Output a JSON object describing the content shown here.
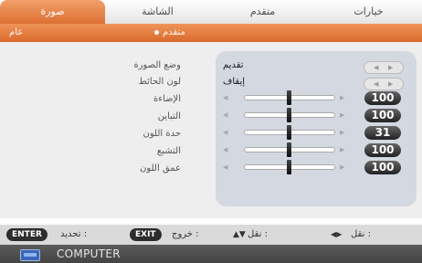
{
  "tabs": [
    {
      "label": "خيارات",
      "active": false
    },
    {
      "label": "متقدم",
      "active": false
    },
    {
      "label": "الشاشة",
      "active": false
    },
    {
      "label": "صورة",
      "active": true
    }
  ],
  "subtabs": {
    "general": "عام",
    "advanced": "متقدم"
  },
  "menu": [
    {
      "label": "وضع الصورة",
      "type": "select",
      "value": "تقديم"
    },
    {
      "label": "لون الحائط",
      "type": "select",
      "value": "إيقاف"
    },
    {
      "label": "الإضاءة",
      "type": "slider",
      "value": "100",
      "level": 0.5
    },
    {
      "label": "التباين",
      "type": "slider",
      "value": "100",
      "level": 0.5
    },
    {
      "label": "حدة اللون",
      "type": "slider",
      "value": "31",
      "level": 0.5
    },
    {
      "label": "التشبع",
      "type": "slider",
      "value": "100",
      "level": 0.5
    },
    {
      "label": "عمق اللون",
      "type": "slider",
      "value": "100",
      "level": 0.5
    }
  ],
  "footer": {
    "nav_lr": "نقل :",
    "nav_ud": "نقل :",
    "exit_key": "EXIT",
    "exit_label": "خروج :",
    "enter_key": "ENTER",
    "enter_label": "تحديد :"
  },
  "source": {
    "name": "COMPUTER"
  },
  "colors": {
    "accent": "#e07a3c",
    "panel": "#d4d8e0",
    "badge": "#333333"
  }
}
